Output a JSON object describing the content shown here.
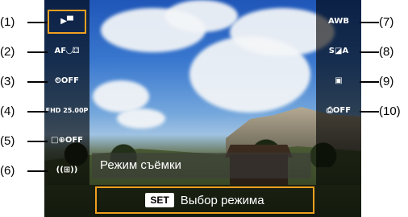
{
  "callouts_left": [
    "(1)",
    "(2)",
    "(3)",
    "(4)",
    "(5)",
    "(6)"
  ],
  "callouts_right": [
    "(7)",
    "(8)",
    "(9)",
    "(10)"
  ],
  "left_items": [
    {
      "icon": "movie-mode-icon",
      "glyph": "▶▀"
    },
    {
      "icon": "af-method-icon",
      "glyph": "AF◡⚃"
    },
    {
      "icon": "self-timer-off-icon",
      "glyph": "⏲OFF"
    },
    {
      "icon": "movie-rec-size-icon",
      "glyph": "FHD 25.00P"
    },
    {
      "icon": "digital-zoom-off-icon",
      "glyph": "□⊕OFF"
    },
    {
      "icon": "image-stabilizer-icon",
      "glyph": "((⊞))"
    }
  ],
  "right_items": [
    {
      "icon": "white-balance-icon",
      "glyph": "AWB"
    },
    {
      "icon": "picture-style-icon",
      "glyph": "S◪A"
    },
    {
      "icon": "auto-lighting-optimizer-icon",
      "glyph": "▣"
    },
    {
      "icon": "movie-self-timer-off-icon",
      "glyph": "⎙OFF"
    }
  ],
  "mode_label": "Режим съёмки",
  "hint": {
    "key": "SET",
    "text": "Выбор режима"
  },
  "colors": {
    "selection": "#f0a020",
    "panel": "#000000"
  }
}
